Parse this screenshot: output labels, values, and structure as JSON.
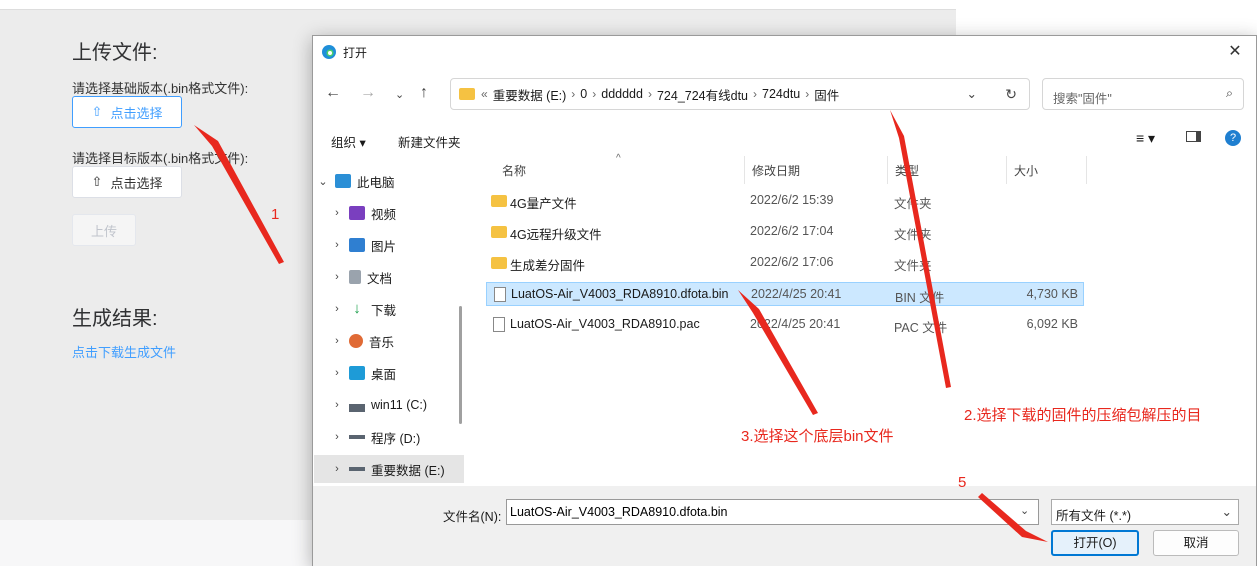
{
  "bg": {
    "upload_title": "上传文件:",
    "base_label": "请选择基础版本(.bin格式文件):",
    "base_btn": "点击选择",
    "target_label": "请选择目标版本(.bin格式文件):",
    "target_btn": "点击选择",
    "upload_btn": "上传",
    "result_title": "生成结果:",
    "download_link": "点击下载生成文件"
  },
  "dialog": {
    "title": "打开",
    "address": {
      "prefix": "«",
      "segments": [
        "重要数据 (E:)",
        "0",
        "dddddd",
        "724_724有线dtu",
        "724dtu",
        "固件"
      ]
    },
    "search_placeholder": "搜索\"固件\"",
    "commands": {
      "organize": "组织 ▾",
      "new_folder": "新建文件夹"
    },
    "nav": [
      {
        "label": "此电脑",
        "icon": "pc-icon",
        "level": 0,
        "expanded": true
      },
      {
        "label": "视频",
        "icon": "video-icon",
        "level": 1
      },
      {
        "label": "图片",
        "icon": "picture-icon",
        "level": 1
      },
      {
        "label": "文档",
        "icon": "document-icon",
        "level": 1
      },
      {
        "label": "下载",
        "icon": "download-icon",
        "level": 1
      },
      {
        "label": "音乐",
        "icon": "music-icon",
        "level": 1
      },
      {
        "label": "桌面",
        "icon": "desktop-icon",
        "level": 1
      },
      {
        "label": "win11 (C:)",
        "icon": "drive-icon",
        "level": 1
      },
      {
        "label": "程序 (D:)",
        "icon": "drive-icon",
        "level": 1
      },
      {
        "label": "重要数据 (E:)",
        "icon": "drive-icon",
        "level": 1,
        "selected": true
      }
    ],
    "columns": {
      "name": "名称",
      "date": "修改日期",
      "type": "类型",
      "size": "大小"
    },
    "files": [
      {
        "name": "4G量产文件",
        "date": "2022/6/2 15:39",
        "type": "文件夹",
        "size": "",
        "kind": "folder"
      },
      {
        "name": "4G远程升级文件",
        "date": "2022/6/2 17:04",
        "type": "文件夹",
        "size": "",
        "kind": "folder"
      },
      {
        "name": "生成差分固件",
        "date": "2022/6/2 17:06",
        "type": "文件夹",
        "size": "",
        "kind": "folder"
      },
      {
        "name": "LuatOS-Air_V4003_RDA8910.dfota.bin",
        "date": "2022/4/25 20:41",
        "type": "BIN 文件",
        "size": "4,730 KB",
        "kind": "file",
        "selected": true
      },
      {
        "name": "LuatOS-Air_V4003_RDA8910.pac",
        "date": "2022/4/25 20:41",
        "type": "PAC 文件",
        "size": "6,092 KB",
        "kind": "file"
      }
    ],
    "filename_label": "文件名(N):",
    "filename_value": "LuatOS-Air_V4003_RDA8910.dfota.bin",
    "filetype": "所有文件 (*.*)",
    "open_btn": "打开(O)",
    "cancel_btn": "取消"
  },
  "annotations": {
    "a1": "1",
    "a2": "2.选择下载的固件的压缩包解压的目",
    "a3": "3.选择这个底层bin文件",
    "a5": "5",
    "color": "#e8281e"
  }
}
